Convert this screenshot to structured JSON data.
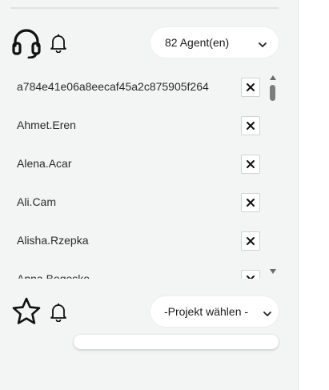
{
  "agents_section": {
    "headset_icon": "headset-icon",
    "bell_icon": "bell-icon",
    "agent_select_label": "82 Agent(en)"
  },
  "agent_list": [
    {
      "name": "a784e41e06a8eecaf45a2c875905f264"
    },
    {
      "name": "Ahmet.Eren"
    },
    {
      "name": "Alena.Acar"
    },
    {
      "name": "Ali.Cam"
    },
    {
      "name": "Alisha.Rzepka"
    },
    {
      "name": "Anna.Bogosko"
    }
  ],
  "project_section": {
    "star_icon": "star-icon",
    "bell_icon": "bell-icon",
    "project_select_label": "-Projekt wählen -"
  },
  "colors": {
    "background": "#f3f5f5",
    "pill": "#ffffff",
    "text": "#1b1b1b"
  }
}
